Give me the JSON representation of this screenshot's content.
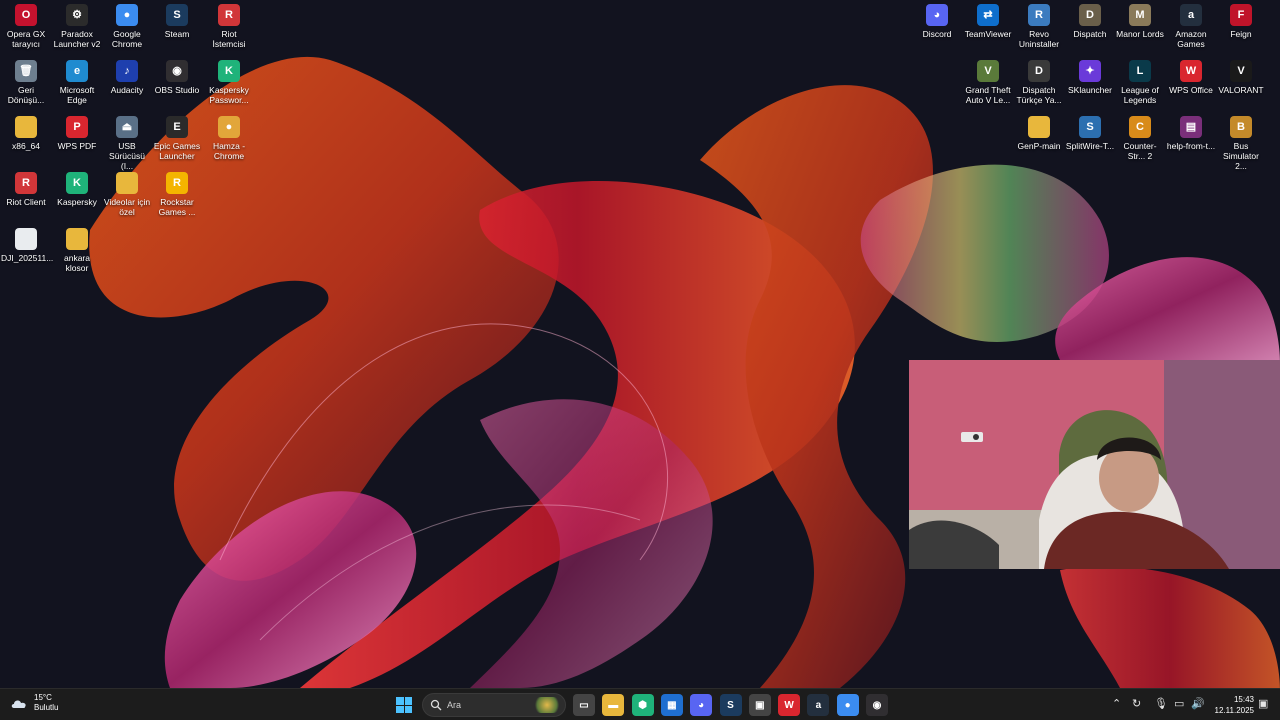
{
  "desktop": {
    "icons": [
      {
        "label": "Opera GX tarayıcı",
        "name": "opera-gx-icon",
        "color": "#c4122e",
        "glyph": "O"
      },
      {
        "label": "Paradox Launcher v2",
        "name": "paradox-launcher-icon",
        "color": "#2b2b2b",
        "glyph": "⚙"
      },
      {
        "label": "Google Chrome",
        "name": "google-chrome-icon",
        "color": "#3b8cf0",
        "glyph": "●"
      },
      {
        "label": "Steam",
        "name": "steam-icon",
        "color": "#1b3b5e",
        "glyph": "S"
      },
      {
        "label": "Riot İstemcisi",
        "name": "riot-client-tr-icon",
        "color": "#d13639",
        "glyph": "R"
      },
      {
        "label": "Geri Dönüşü...",
        "name": "recycle-bin-icon",
        "color": "#6e7f8f",
        "glyph": "🗑"
      },
      {
        "label": "Microsoft Edge",
        "name": "microsoft-edge-icon",
        "color": "#1f8bd0",
        "glyph": "e"
      },
      {
        "label": "Audacity",
        "name": "audacity-icon",
        "color": "#1e3fae",
        "glyph": "♪"
      },
      {
        "label": "OBS Studio",
        "name": "obs-studio-icon",
        "color": "#302e31",
        "glyph": "◉"
      },
      {
        "label": "Kaspersky Passwor...",
        "name": "kaspersky-password-icon",
        "color": "#1fb37a",
        "glyph": "K"
      },
      {
        "label": "x86_64",
        "name": "folder-x86-icon",
        "color": "#e8b73c",
        "glyph": ""
      },
      {
        "label": "WPS PDF",
        "name": "wps-pdf-icon",
        "color": "#d9262f",
        "glyph": "P"
      },
      {
        "label": "USB Sürücüsü (I...",
        "name": "usb-drive-icon",
        "color": "#5a7087",
        "glyph": "⏏"
      },
      {
        "label": "Epic Games Launcher",
        "name": "epic-games-icon",
        "color": "#2a2a2a",
        "glyph": "E"
      },
      {
        "label": "Hamza - Chrome",
        "name": "hamza-chrome-icon",
        "color": "#e2a63a",
        "glyph": "●"
      },
      {
        "label": "Riot Client",
        "name": "riot-client-icon",
        "color": "#d13639",
        "glyph": "R"
      },
      {
        "label": "Kaspersky",
        "name": "kaspersky-icon",
        "color": "#1fb37a",
        "glyph": "K"
      },
      {
        "label": "Videolar için özel",
        "name": "videolar-folder-icon",
        "color": "#e8b73c",
        "glyph": ""
      },
      {
        "label": "Rockstar Games ...",
        "name": "rockstar-games-icon",
        "color": "#f4b400",
        "glyph": "R"
      },
      {
        "label": "DJI_202511...",
        "name": "dji-file-icon",
        "color": "#e9ecef",
        "glyph": ""
      },
      {
        "label": "ankara klosor",
        "name": "ankara-folder-icon",
        "color": "#e8b73c",
        "glyph": ""
      },
      {
        "label": "Discord",
        "name": "discord-icon",
        "color": "#5865f2",
        "glyph": "◕"
      },
      {
        "label": "TeamViewer",
        "name": "teamviewer-icon",
        "color": "#0e6ecc",
        "glyph": "⇄"
      },
      {
        "label": "Revo Uninstaller",
        "name": "revo-uninstaller-icon",
        "color": "#3b7bbf",
        "glyph": "R"
      },
      {
        "label": "Dispatch",
        "name": "dispatch-icon",
        "color": "#6a5f4a",
        "glyph": "D"
      },
      {
        "label": "Manor Lords",
        "name": "manor-lords-icon",
        "color": "#8a7a5a",
        "glyph": "M"
      },
      {
        "label": "Amazon Games",
        "name": "amazon-games-icon",
        "color": "#232f3e",
        "glyph": "a"
      },
      {
        "label": "Feign",
        "name": "feign-icon",
        "color": "#c0142a",
        "glyph": "F"
      },
      {
        "label": "Grand Theft Auto V Le...",
        "name": "gta-v-icon",
        "color": "#5a7a3a",
        "glyph": "V"
      },
      {
        "label": "Dispatch Türkçe Ya...",
        "name": "dispatch-turkce-icon",
        "color": "#3a3a3a",
        "glyph": "D"
      },
      {
        "label": "SKlauncher",
        "name": "sklauncher-icon",
        "color": "#6a3ad9",
        "glyph": "✦"
      },
      {
        "label": "League of Legends",
        "name": "league-of-legends-icon",
        "color": "#0a3a4a",
        "glyph": "L"
      },
      {
        "label": "WPS Office",
        "name": "wps-office-icon",
        "color": "#d9262f",
        "glyph": "W"
      },
      {
        "label": "VALORANT",
        "name": "valorant-icon",
        "color": "#1a1a1a",
        "glyph": "V"
      },
      {
        "label": "GenP-main",
        "name": "genp-folder-icon",
        "color": "#e8b73c",
        "glyph": ""
      },
      {
        "label": "SplitWire-T...",
        "name": "splitwire-icon",
        "color": "#2c6fb0",
        "glyph": "S"
      },
      {
        "label": "Counter-Str... 2",
        "name": "counter-strike-icon",
        "color": "#d88b1a",
        "glyph": "C"
      },
      {
        "label": "help-from-t...",
        "name": "help-from-winrar-icon",
        "color": "#7a2f7a",
        "glyph": "▤"
      },
      {
        "label": "Bus Simulator 2...",
        "name": "bus-simulator-icon",
        "color": "#c48a2a",
        "glyph": "B"
      }
    ]
  },
  "webcam": {
    "label": "webcam-overlay"
  },
  "taskbar": {
    "weather_temp": "15°C",
    "weather_text": "Bulutlu",
    "search_placeholder": "Ara",
    "apps": [
      {
        "name": "task-view-icon",
        "color": "#444",
        "glyph": "▭"
      },
      {
        "name": "file-explorer-icon",
        "color": "#e8b73c",
        "glyph": "▬"
      },
      {
        "name": "kaspersky-taskbar-icon",
        "color": "#1fb37a",
        "glyph": "⬢"
      },
      {
        "name": "app-taskbar-icon",
        "color": "#1f6fd0",
        "glyph": "▦"
      },
      {
        "name": "discord-taskbar-icon",
        "color": "#5865f2",
        "glyph": "◕"
      },
      {
        "name": "steam-taskbar-icon",
        "color": "#1b3b5e",
        "glyph": "S"
      },
      {
        "name": "store-taskbar-icon",
        "color": "#444",
        "glyph": "▣"
      },
      {
        "name": "wps-taskbar-icon",
        "color": "#d9262f",
        "glyph": "W"
      },
      {
        "name": "amazon-games-taskbar-icon",
        "color": "#232f3e",
        "glyph": "a"
      },
      {
        "name": "chrome-taskbar-icon",
        "color": "#3b8cf0",
        "glyph": "●"
      },
      {
        "name": "obs-taskbar-icon",
        "color": "#302e31",
        "glyph": "◉"
      }
    ],
    "time": "15:43",
    "date": "12.11.2025"
  }
}
